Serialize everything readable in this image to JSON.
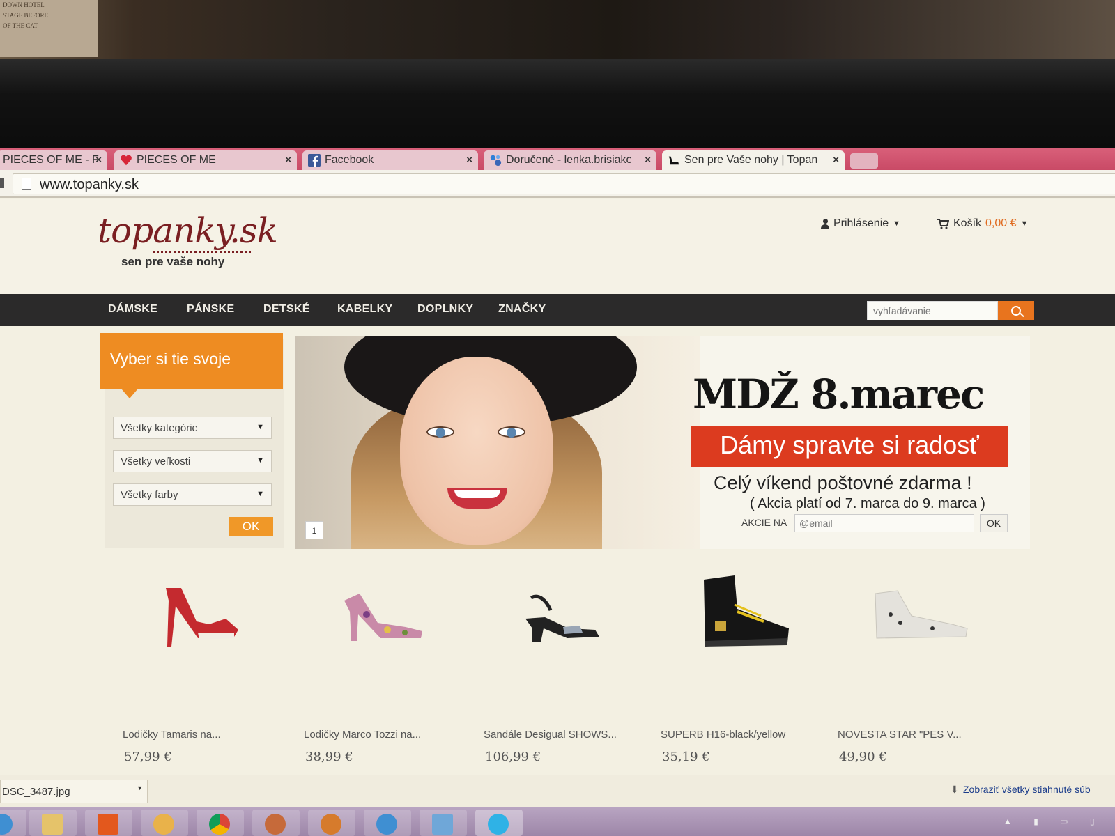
{
  "background": {
    "poster_lines": [
      "DOWN HOTEL",
      "STAGE BEFORE",
      "OF THE CAT"
    ]
  },
  "browser": {
    "tabs": [
      {
        "title": "PIECES OF ME - F",
        "icon": "page-icon"
      },
      {
        "title": "PIECES OF ME",
        "icon": "heart-icon"
      },
      {
        "title": "Facebook",
        "icon": "facebook-icon"
      },
      {
        "title": "Doručené - lenka.brisiakov",
        "icon": "mail-icon"
      },
      {
        "title": "Sen pre Vaše nohy | Topan",
        "icon": "shoe-icon"
      }
    ],
    "close_glyph": "×",
    "url": "www.topanky.sk"
  },
  "site": {
    "logo": "topanky.sk",
    "tagline": "sen pre vaše nohy",
    "login_label": "Prihlásenie",
    "cart_label": "Košík",
    "cart_total": "0,00 €",
    "nav": [
      "DÁMSKE",
      "PÁNSKE",
      "DETSKÉ",
      "KABELKY",
      "DOPLNKY",
      "ZNAČKY"
    ],
    "search_placeholder": "vyhľadávanie"
  },
  "filter": {
    "title": "Vyber si tie svoje",
    "selects": [
      "Všetky kategórie",
      "Všetky veľkosti",
      "Všetky farby"
    ],
    "ok_label": "OK"
  },
  "banner": {
    "slide_number": "1",
    "headline": "MDŽ 8.marec",
    "red_line": "Dámy spravte si radosť",
    "line1": "Celý víkend poštovné zdarma !",
    "line2": "( Akcia platí od 7. marca do 9. marca )",
    "akcie_label": "AKCIE NA",
    "email_placeholder": "@email",
    "email_ok": "OK"
  },
  "products": [
    {
      "name": "Lodičky Tamaris na...",
      "price": "57,99 €",
      "color": "#c42a2f"
    },
    {
      "name": "Lodičky Marco Tozzi na...",
      "price": "38,99 €",
      "color": "#c98aa8"
    },
    {
      "name": "Sandále Desigual SHOWS...",
      "price": "106,99 €",
      "color": "#222222"
    },
    {
      "name": "SUPERB H16-black/yellow",
      "price": "35,19 €",
      "color": "#151515"
    },
    {
      "name": "NOVESTA STAR \"PES V...",
      "price": "49,90 €",
      "color": "#e4e2dc"
    }
  ],
  "downloads": {
    "file": "DSC_3487.jpg",
    "show_all": "Zobraziť všetky stiahnuté súb"
  }
}
